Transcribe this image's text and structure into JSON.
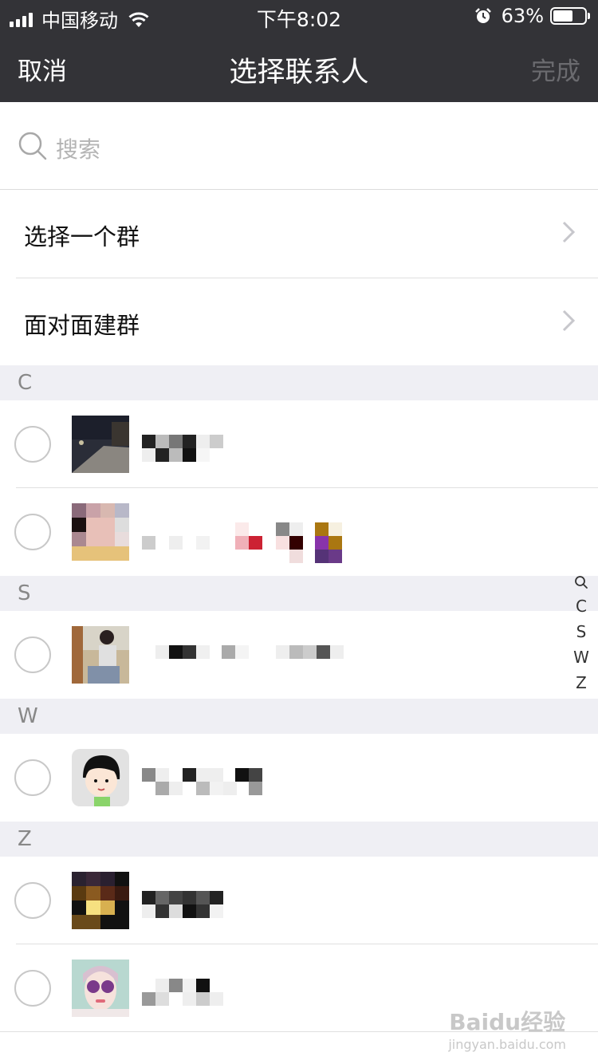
{
  "status_bar": {
    "carrier": "中国移动",
    "time": "下午8:02",
    "battery_percent": "63%",
    "battery_level": 0.63,
    "icons": [
      "signal-icon",
      "wifi-icon",
      "alarm-icon",
      "battery-icon"
    ]
  },
  "navbar": {
    "cancel_label": "取消",
    "title": "选择联系人",
    "done_label": "完成"
  },
  "search": {
    "placeholder": "搜索",
    "icon": "search-icon"
  },
  "entries": [
    {
      "label": "选择一个群",
      "icon": "chevron-right-icon"
    },
    {
      "label": "面对面建群",
      "icon": "chevron-right-icon"
    }
  ],
  "sections": [
    {
      "letter": "C",
      "contacts": [
        {
          "name": "",
          "avatar": "night-street-photo",
          "pixel_colors": [
            "#222222",
            "#bbbbbb",
            "#777777",
            "#222222",
            "#eeeeee",
            "#cccccc"
          ]
        },
        {
          "name": "",
          "avatar": "blurred-face-photo",
          "pixel_colors": [
            "#cccccc",
            "#eeeeee",
            "#f8d0d0",
            "#cc2233",
            "#999999",
            "#330000",
            "#aa7711",
            "#8833aa",
            "#553377"
          ]
        }
      ]
    },
    {
      "letter": "S",
      "contacts": [
        {
          "name": "",
          "avatar": "woman-sitting-photo",
          "pixel_colors": [
            "#111111",
            "#333333",
            "#aaaaaa",
            "#bbbbbb",
            "#555555",
            "#eeeeee"
          ]
        }
      ]
    },
    {
      "letter": "W",
      "contacts": [
        {
          "name": "",
          "avatar": "cartoon-boy-avatar",
          "pixel_colors": [
            "#888888",
            "#222222",
            "#aaaaaa",
            "#111111",
            "#999999",
            "#eeeeee"
          ]
        }
      ]
    },
    {
      "letter": "Z",
      "contacts": [
        {
          "name": "",
          "avatar": "candle-light-photo",
          "pixel_colors": [
            "#222222",
            "#666666",
            "#444444",
            "#111111",
            "#555555",
            "#eeeeee"
          ]
        },
        {
          "name": "",
          "avatar": "sunglasses-woman-photo",
          "pixel_colors": [
            "#cccccc",
            "#888888",
            "#111111",
            "#999999",
            "#eeeeee",
            "#dddddd"
          ]
        }
      ]
    }
  ],
  "index_bar": [
    "C",
    "S",
    "W",
    "Z"
  ],
  "watermark": {
    "brand": "Baidu经验",
    "url": "jingyan.baidu.com"
  }
}
